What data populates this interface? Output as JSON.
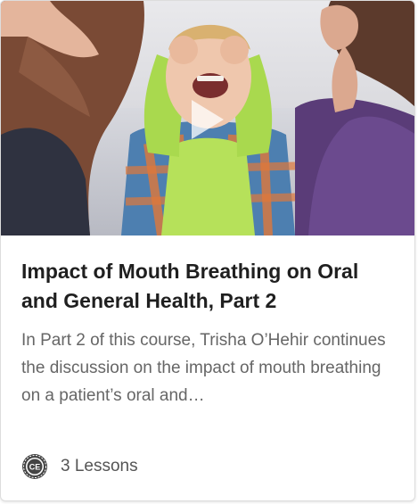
{
  "card": {
    "title": "Impact of Mouth Breathing on Oral and General Health, Part 2",
    "description": "In Part 2 of this course, Trisha O’Hehir continues the discussion on the impact of mouth breathing on a patient’s oral and…",
    "badge_text": "CE",
    "lessons": "3 Lessons"
  },
  "icons": {
    "play": "play-icon",
    "badge": "ce-badge-icon"
  },
  "colors": {
    "title": "#1f1f1f",
    "description": "#666666",
    "badge": "#444444"
  }
}
